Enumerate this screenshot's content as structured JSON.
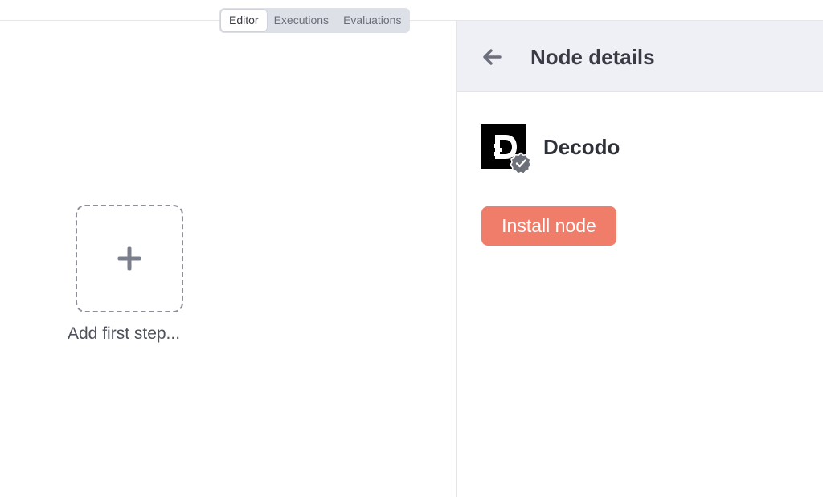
{
  "tabs": [
    {
      "label": "Editor",
      "active": true
    },
    {
      "label": "Executions",
      "active": false
    },
    {
      "label": "Evaluations",
      "active": false
    }
  ],
  "canvas": {
    "add_step_icon": "plus-icon",
    "add_step_label": "Add first step..."
  },
  "panel": {
    "back_icon": "arrow-left-icon",
    "title": "Node details",
    "node": {
      "name": "Decodo",
      "logo_icon": "decodo-logo",
      "verified_icon": "verified-badge-icon"
    },
    "install_button_label": "Install node"
  },
  "colors": {
    "accent": "#ef7d6a",
    "panel_header_bg": "#eef0f5",
    "tab_bar_bg": "#dde0e6"
  }
}
